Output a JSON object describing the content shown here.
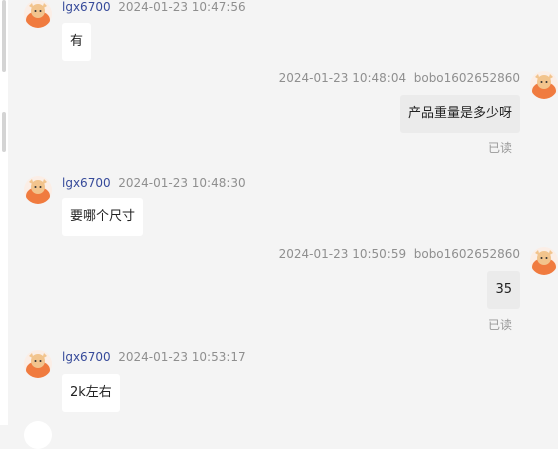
{
  "messages": [
    {
      "side": "left",
      "name": "lgx6700",
      "time": "2024-01-23 10:47:56",
      "text": "有"
    },
    {
      "side": "right",
      "name": "bobo1602652860",
      "time": "2024-01-23 10:48:04",
      "text": "产品重量是多少呀",
      "status": "已读"
    },
    {
      "side": "left",
      "name": "lgx6700",
      "time": "2024-01-23 10:48:30",
      "text": "要哪个尺寸"
    },
    {
      "side": "right",
      "name": "bobo1602652860",
      "time": "2024-01-23 10:50:59",
      "text": "35",
      "status": "已读"
    },
    {
      "side": "left",
      "name": "lgx6700",
      "time": "2024-01-23 10:53:17",
      "text": "2k左右"
    }
  ],
  "colors": {
    "background": "#f4f4f4",
    "username": "#364a9a",
    "avatar": "#f07b3f"
  },
  "icons": {
    "avatar": "cartoon-animal-avatar-icon"
  }
}
